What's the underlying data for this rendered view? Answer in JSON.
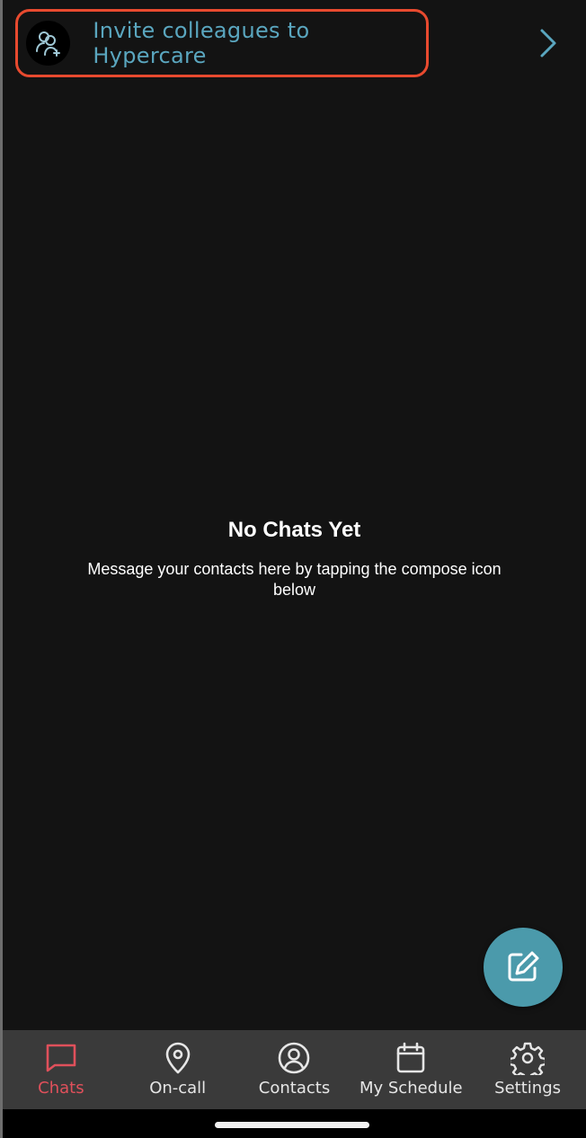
{
  "banner": {
    "text": "Invite colleagues to Hypercare",
    "icon": "invite-user-icon",
    "chevron_icon": "chevron-right-icon",
    "text_color": "#5aa6bf",
    "highlight_color": "#e84a2f"
  },
  "empty_state": {
    "title": "No Chats Yet",
    "message": "Message your contacts here by tapping the compose icon below"
  },
  "fab": {
    "icon": "compose-icon",
    "color": "#4b9aab"
  },
  "tabs": [
    {
      "label": "Chats",
      "icon": "chat-icon",
      "active": true
    },
    {
      "label": "On-call",
      "icon": "location-pin-icon",
      "active": false
    },
    {
      "label": "Contacts",
      "icon": "user-circle-icon",
      "active": false
    },
    {
      "label": "My Schedule",
      "icon": "calendar-icon",
      "active": false
    },
    {
      "label": "Settings",
      "icon": "gear-icon",
      "active": false
    }
  ],
  "colors": {
    "background": "#131313",
    "tabbar": "#3a3a3a",
    "active_tab": "#e0505b"
  }
}
